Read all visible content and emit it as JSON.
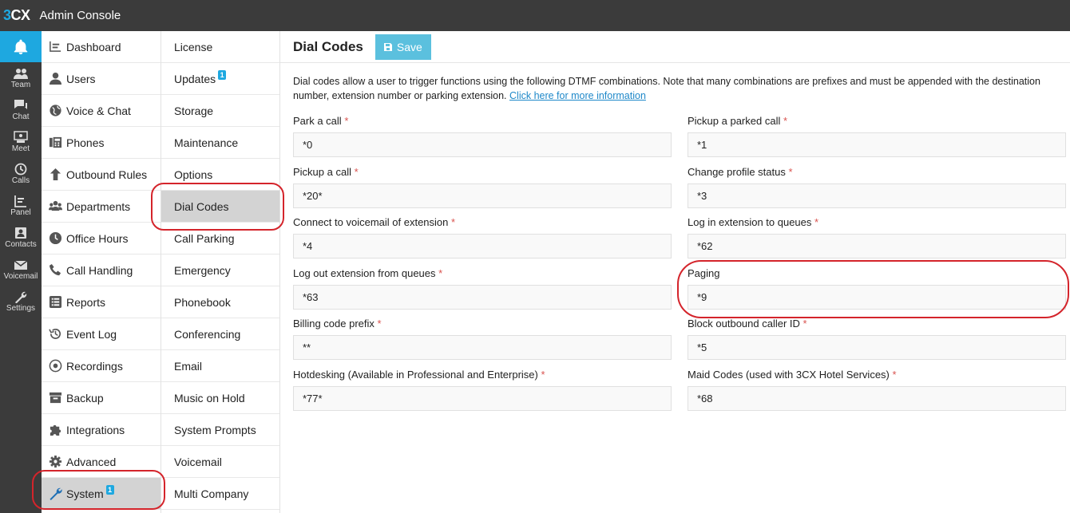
{
  "app": {
    "logo": "3CX",
    "title": "Admin Console"
  },
  "iconbar": [
    {
      "label": "Team",
      "icon": "team-icon"
    },
    {
      "label": "Chat",
      "icon": "chat-icon"
    },
    {
      "label": "Meet",
      "icon": "meet-icon"
    },
    {
      "label": "Calls",
      "icon": "calls-icon"
    },
    {
      "label": "Panel",
      "icon": "panel-icon"
    },
    {
      "label": "Contacts",
      "icon": "contacts-icon"
    },
    {
      "label": "Voicemail",
      "icon": "voicemail-icon"
    },
    {
      "label": "Settings",
      "icon": "settings-icon"
    }
  ],
  "nav_primary": [
    {
      "label": "Dashboard",
      "icon": "dashboard-icon"
    },
    {
      "label": "Users",
      "icon": "user-icon"
    },
    {
      "label": "Voice & Chat",
      "icon": "globe-icon"
    },
    {
      "label": "Phones",
      "icon": "phone-device-icon"
    },
    {
      "label": "Outbound Rules",
      "icon": "arrow-up-icon"
    },
    {
      "label": "Departments",
      "icon": "group-icon"
    },
    {
      "label": "Office Hours",
      "icon": "clock-icon"
    },
    {
      "label": "Call Handling",
      "icon": "phone-icon"
    },
    {
      "label": "Reports",
      "icon": "list-icon"
    },
    {
      "label": "Event Log",
      "icon": "history-icon"
    },
    {
      "label": "Recordings",
      "icon": "record-icon"
    },
    {
      "label": "Backup",
      "icon": "archive-icon"
    },
    {
      "label": "Integrations",
      "icon": "puzzle-icon"
    },
    {
      "label": "Advanced",
      "icon": "gear-icon"
    },
    {
      "label": "System",
      "icon": "wrench-icon",
      "badge": "1",
      "active": true
    }
  ],
  "nav_secondary": [
    {
      "label": "License"
    },
    {
      "label": "Updates",
      "badge": "1"
    },
    {
      "label": "Storage"
    },
    {
      "label": "Maintenance"
    },
    {
      "label": "Options"
    },
    {
      "label": "Dial Codes",
      "active": true
    },
    {
      "label": "Call Parking"
    },
    {
      "label": "Emergency"
    },
    {
      "label": "Phonebook"
    },
    {
      "label": "Conferencing"
    },
    {
      "label": "Email"
    },
    {
      "label": "Music on Hold"
    },
    {
      "label": "System Prompts"
    },
    {
      "label": "Voicemail"
    },
    {
      "label": "Multi Company"
    }
  ],
  "main": {
    "title": "Dial Codes",
    "save_label": "Save",
    "description": "Dial codes allow a user to trigger functions using the following DTMF combinations. Note that many combinations are prefixes and must be appended with the destination number, extension number or parking extension.",
    "more_info_link": "Click here for more information"
  },
  "fields": [
    {
      "label": "Park a call",
      "value": "*0",
      "required": true
    },
    {
      "label": "Pickup a parked call",
      "value": "*1",
      "required": true
    },
    {
      "label": "Pickup a call",
      "value": "*20*",
      "required": true
    },
    {
      "label": "Change profile status",
      "value": "*3",
      "required": true
    },
    {
      "label": "Connect to voicemail of extension",
      "value": "*4",
      "required": true
    },
    {
      "label": "Log in extension to queues",
      "value": "*62",
      "required": true
    },
    {
      "label": "Log out extension from queues",
      "value": "*63",
      "required": true
    },
    {
      "label": "Paging",
      "value": "*9",
      "required": false
    },
    {
      "label": "Billing code prefix",
      "value": "**",
      "required": true
    },
    {
      "label": "Block outbound caller ID",
      "value": "*5",
      "required": true
    },
    {
      "label": "Hotdesking (Available in Professional and Enterprise)",
      "value": "*77*",
      "required": true
    },
    {
      "label": "Maid Codes (used with 3CX Hotel Services)",
      "value": "*68",
      "required": true
    }
  ],
  "colors": {
    "accent": "#1ea8e0",
    "topbar": "#3b3b3b",
    "annotation": "#d4242b",
    "required": "#d9534f"
  }
}
